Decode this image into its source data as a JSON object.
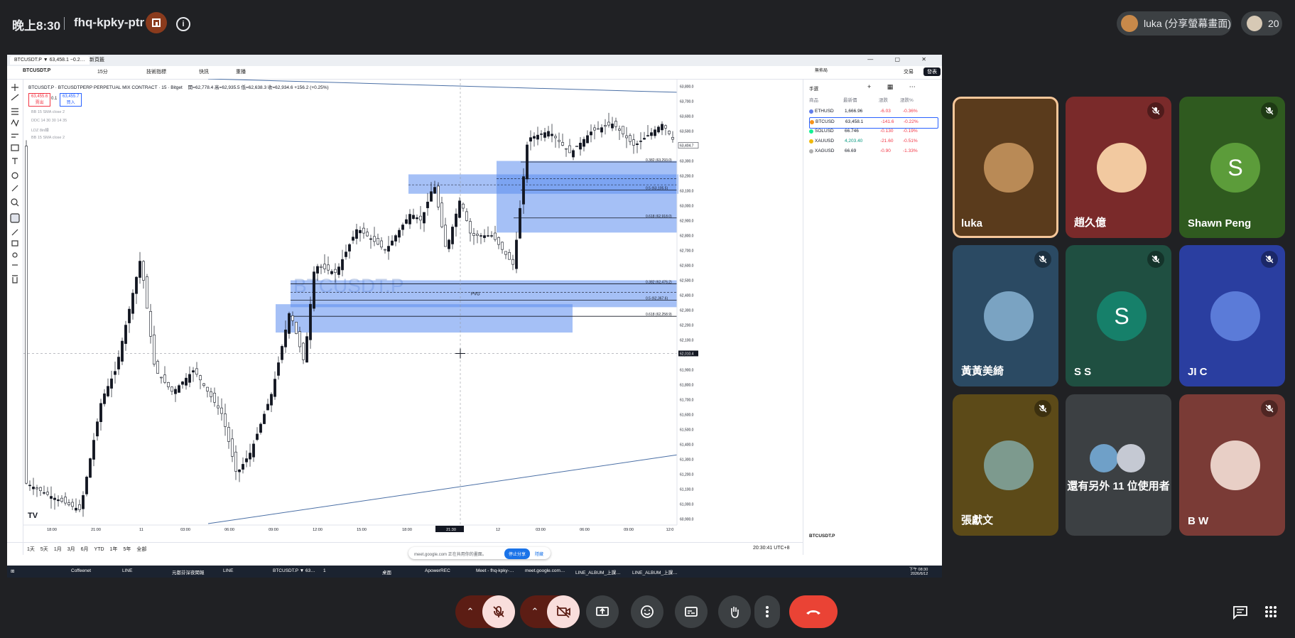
{
  "topbar": {
    "time": "晚上8:30",
    "meeting_code": "fhq-kpky-ptr",
    "presenter_label": "luka (分享螢幕畫面)",
    "participant_count": "20"
  },
  "shared_screen": {
    "tabs": [
      "BTCUSDT.P ▼ 63,458.1 −0.2…",
      "新頁籤"
    ],
    "symbol": "BTCUSDT.P",
    "timeframe": "15分",
    "indicators_label": "技術指標",
    "alert_label": "快訊",
    "replay_label": "重播",
    "layout_label": "無佈局",
    "trade_label": "交易",
    "publish_label": "發表",
    "chart_title": "BTCUSDT.P · BTCUSDTPERP PERPETUAL MIX CONTRACT · 15 · Bitget",
    "ohlc": "開=62,778.4  高=62,935.5  低=62,638.3  收=62,934.6  +156.2 (+0.25%)",
    "sell_price": "63,455.6",
    "sell_label": "賣出",
    "spread": "0.1",
    "buy_price": "63,455.7",
    "buy_label": "買入",
    "indicator_rows": [
      "BB 15 SMA close 2",
      "DDC 14 30 30 14 35",
      "LDZ 8in線",
      "BB 15 SMA close 2"
    ],
    "watermark": "BTCUSDT.P",
    "fvg_label": "PVG",
    "fib_upper": [
      "0.382 (63,293.0)",
      "0.5 (63,105.5)",
      "0.618 (62,918.0)"
    ],
    "fib_lower": [
      "0.382 (62,476.2)",
      "0.5 (62,367.6)",
      "0.618 (62,258.9)"
    ],
    "cursor_price": "62,010.4",
    "last_price_tag": "63,404.7",
    "price_ticks": [
      "63,800.0",
      "63,700.0",
      "63,600.0",
      "63,500.0",
      "63,400.0",
      "63,300.0",
      "63,200.0",
      "63,100.0",
      "63,000.0",
      "62,900.0",
      "62,800.0",
      "62,700.0",
      "62,600.0",
      "62,500.0",
      "62,400.0",
      "62,300.0",
      "62,200.0",
      "62,100.0",
      "62,000.0",
      "61,900.0",
      "61,800.0",
      "61,700.0",
      "61,600.0",
      "61,500.0",
      "61,400.0",
      "61,300.0",
      "61,200.0",
      "61,100.0",
      "61,000.0",
      "60,900.0"
    ],
    "time_ticks": [
      "18:00",
      "21:00",
      "11",
      "03:00",
      "06:00",
      "09:00",
      "12:00",
      "15:00",
      "18:00",
      "21:30",
      "12",
      "03:00",
      "06:00",
      "09:00",
      "12:0"
    ],
    "range_buttons": [
      "1天",
      "5天",
      "1月",
      "3月",
      "6月",
      "YTD",
      "1年",
      "5年",
      "全部"
    ],
    "clock": "20:30:41 UTC+8",
    "watchlist_title": "手選",
    "watchlist_headers": [
      "商品",
      "最新價",
      "漲跌",
      "漲跌%"
    ],
    "watchlist": [
      {
        "sym": "ETHUSD",
        "last": "1,666.96",
        "chg": "-6.03",
        "pct": "-0.36%"
      },
      {
        "sym": "BTCUSD",
        "last": "63,458.1",
        "chg": "-141.6",
        "pct": "-0.22%"
      },
      {
        "sym": "SOLUSD",
        "last": "66.746",
        "chg": "-0.130",
        "pct": "-0.19%"
      },
      {
        "sym": "XAUUSD",
        "last": "4,203.40",
        "chg": "-21.60",
        "pct": "-0.51%"
      },
      {
        "sym": "XAGUSD",
        "last": "66.69",
        "chg": "-0.90",
        "pct": "-1.33%"
      }
    ],
    "watch_footer_symbol": "BTCUSDT.P",
    "share_notice": "meet.google.com 正在共用你的畫面。",
    "share_stop": "停止分享",
    "share_hide": "隱藏",
    "taskbar_items": [
      "Coffeenet",
      "LINE",
      "元都芬深夜聞報",
      "LINE",
      "BTCUSDT.P ▼ 63…",
      "1",
      "桌面",
      "ApowerREC",
      "Meet - fhq-kpky-…",
      "meet.google.com…",
      "LINE_ALBUM_上課…",
      "LINE_ALBUM_上課…"
    ],
    "taskbar_time": "下午 08:30",
    "taskbar_date": "2026/6/12"
  },
  "participants": [
    {
      "name": "luka",
      "muted": false,
      "kind": "photo",
      "bg": "#5a3b1c",
      "avatar_color": "#b98a56"
    },
    {
      "name": "趙久億",
      "muted": true,
      "kind": "photo",
      "bg": "#7a2a2a",
      "avatar_color": "#f2c9a0"
    },
    {
      "name": "Shawn Peng",
      "muted": true,
      "kind": "letter",
      "letter": "S",
      "bg": "#2f5a1f",
      "avatar_color": "#5c9c3a"
    },
    {
      "name": "黃黃美綺",
      "muted": true,
      "kind": "photo",
      "bg": "#2b4a63",
      "avatar_color": "#7aa3c2"
    },
    {
      "name": "S S",
      "muted": true,
      "kind": "letter",
      "letter": "S",
      "bg": "#1f4f41",
      "avatar_color": "#16806a"
    },
    {
      "name": "JI C",
      "muted": true,
      "kind": "photo",
      "bg": "#2a3ea0",
      "avatar_color": "#5b7bd8"
    },
    {
      "name": "張獻文",
      "muted": true,
      "kind": "photo",
      "bg": "#5c4a18",
      "avatar_color": "#7d9a8e"
    },
    {
      "name": "還有另外 11 位使用者",
      "muted": false,
      "kind": "group",
      "bg": "#3c4043",
      "avatar_color": "#6f8aa3"
    },
    {
      "name": "B W",
      "muted": true,
      "kind": "photo",
      "bg": "#7a3b36",
      "avatar_color": "#e8cfc6"
    }
  ],
  "colors": {
    "up_candle": "#131722",
    "down_candle": "#ffffff",
    "zone_blue": "#5b8def",
    "trend_line": "#4a6fa5",
    "leave_button": "#ea4335",
    "muted_control": "#f9dedc"
  },
  "icons": {
    "mic": "mic-off-icon",
    "camera": "camera-off-icon",
    "present": "present-icon",
    "emoji": "emoji-icon",
    "captions": "captions-icon",
    "hand": "raise-hand-icon",
    "more": "more-vert-icon",
    "leave": "call-end-icon",
    "chat": "chat-icon",
    "activities": "apps-icon"
  }
}
